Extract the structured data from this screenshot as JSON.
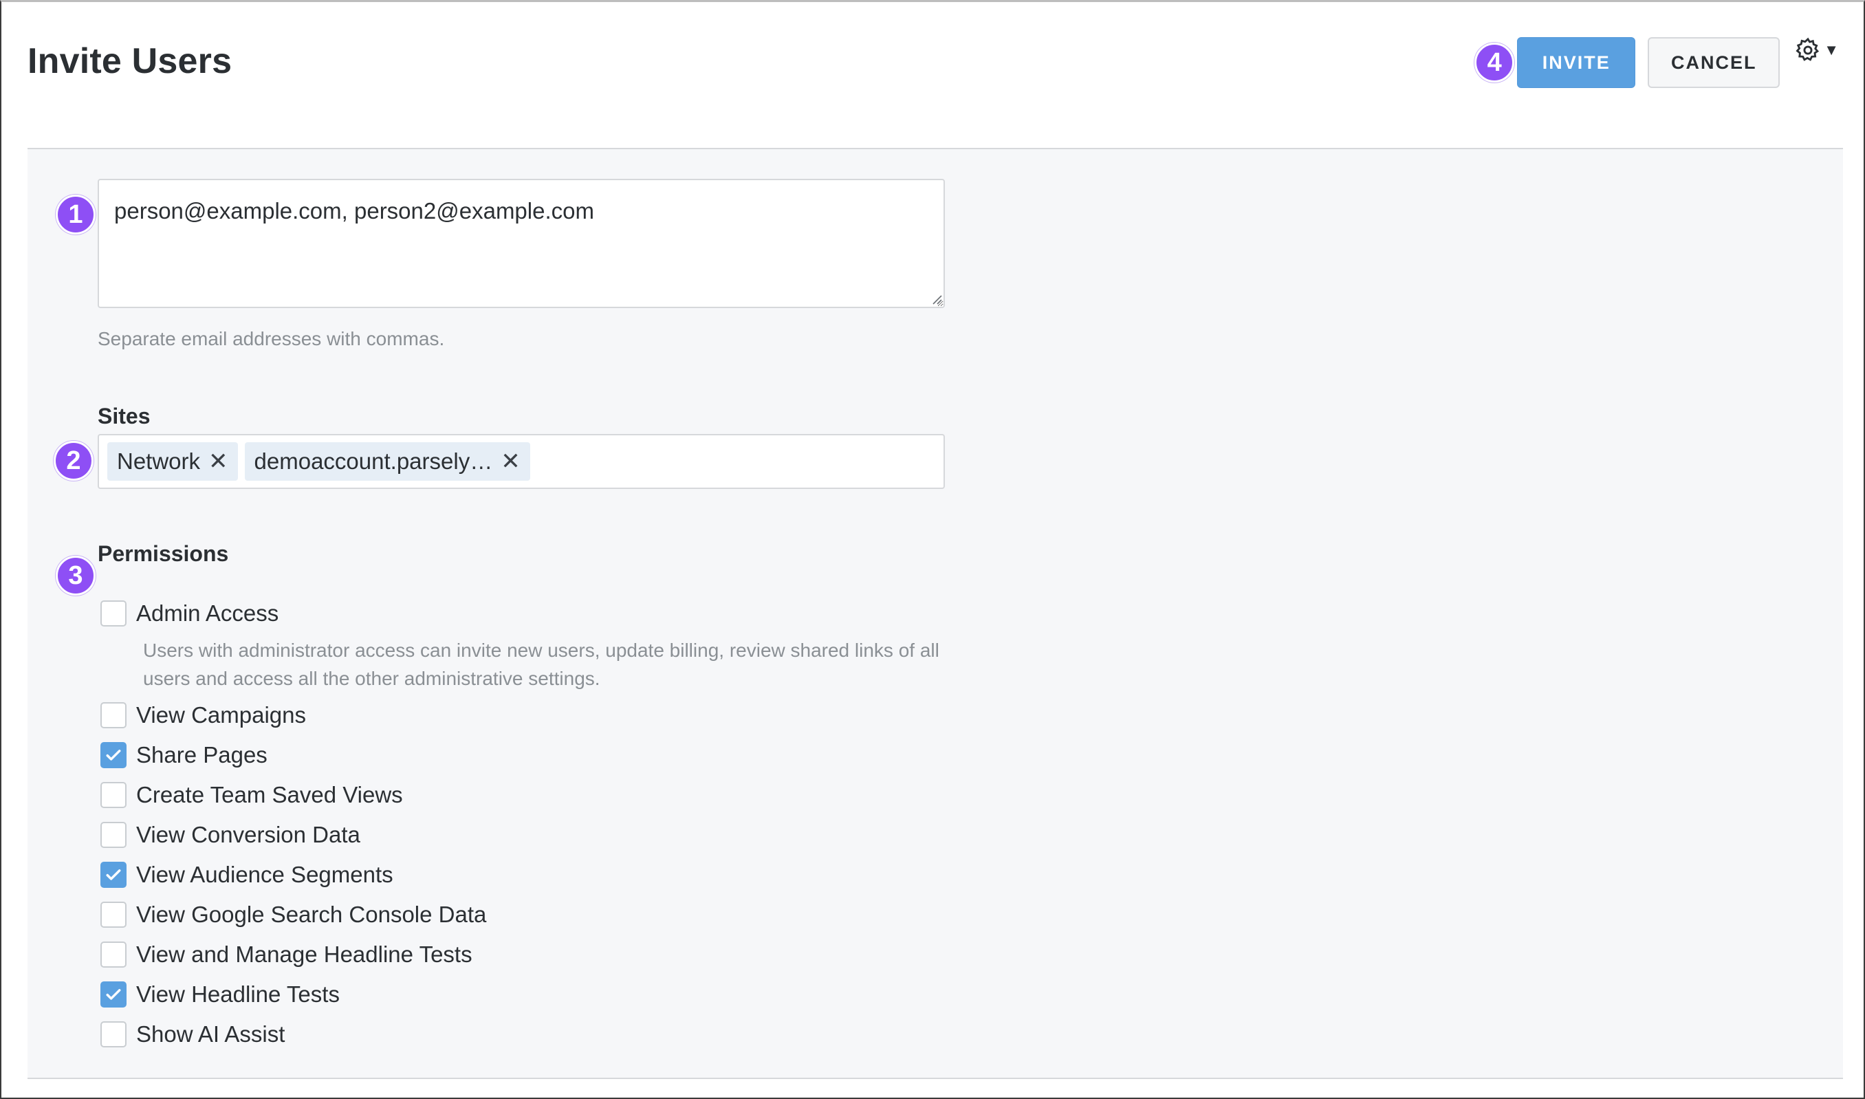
{
  "header": {
    "title": "Invite Users",
    "step_badge": "4",
    "invite_label": "INVITE",
    "cancel_label": "CANCEL",
    "settings_icon": "gear-icon"
  },
  "form": {
    "emails": {
      "badge": "1",
      "value": "person@example.com, person2@example.com",
      "help": "Separate email addresses with commas."
    },
    "sites": {
      "badge": "2",
      "label": "Sites",
      "chips": [
        {
          "label": "Network"
        },
        {
          "label": "demoaccount.parsely…"
        }
      ]
    },
    "permissions": {
      "badge": "3",
      "label": "Permissions",
      "items": [
        {
          "label": "Admin Access",
          "checked": false,
          "description": "Users with administrator access can invite new users, update billing, review shared links of all users and access all the other administrative settings."
        },
        {
          "label": "View Campaigns",
          "checked": false
        },
        {
          "label": "Share Pages",
          "checked": true
        },
        {
          "label": "Create Team Saved Views",
          "checked": false
        },
        {
          "label": "View Conversion Data",
          "checked": false
        },
        {
          "label": "View Audience Segments",
          "checked": true
        },
        {
          "label": "View Google Search Console Data",
          "checked": false
        },
        {
          "label": "View and Manage Headline Tests",
          "checked": false
        },
        {
          "label": "View Headline Tests",
          "checked": true
        },
        {
          "label": "Show AI Assist",
          "checked": false
        }
      ]
    }
  },
  "colors": {
    "accent": "#5aa0e0",
    "badge": "#8e4ff5",
    "panel_bg": "#f6f7f9"
  }
}
